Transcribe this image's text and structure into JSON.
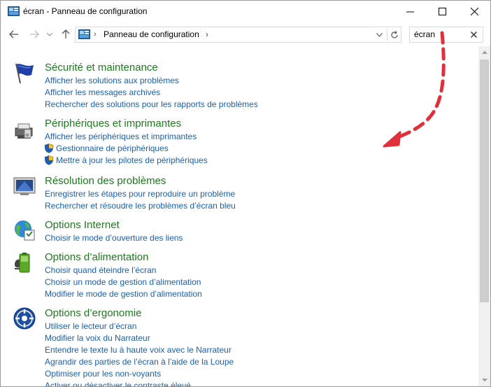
{
  "window": {
    "title": "écran - Panneau de configuration"
  },
  "address": {
    "path_label": "Panneau de configuration",
    "separator": "›"
  },
  "search": {
    "value": "écran"
  },
  "groups": [
    {
      "title": "Sécurité et maintenance",
      "icon": "flag-icon",
      "links": [
        {
          "label": "Afficher les solutions aux problèmes",
          "shield": false
        },
        {
          "label": "Afficher les messages archivés",
          "shield": false
        },
        {
          "label": "Rechercher des solutions pour les rapports de problèmes",
          "shield": false
        }
      ]
    },
    {
      "title": "Périphériques et imprimantes",
      "icon": "printer-icon",
      "links": [
        {
          "label": "Afficher les périphériques et imprimantes",
          "shield": false
        },
        {
          "label": "Gestionnaire de périphériques",
          "shield": true
        },
        {
          "label": "Mettre à jour les pilotes de périphériques",
          "shield": true
        }
      ]
    },
    {
      "title": "Résolution des problèmes",
      "icon": "troubleshoot-monitor-icon",
      "links": [
        {
          "label": "Enregistrer les étapes pour reproduire un problème",
          "shield": false
        },
        {
          "label": "Rechercher et résoudre les problèmes d’écran bleu",
          "shield": false
        }
      ]
    },
    {
      "title": "Options Internet",
      "icon": "globe-icon",
      "links": [
        {
          "label": "Choisir le mode d’ouverture des liens",
          "shield": false
        }
      ]
    },
    {
      "title": "Options d’alimentation",
      "icon": "battery-icon",
      "links": [
        {
          "label": "Choisir quand éteindre l’écran",
          "shield": false
        },
        {
          "label": "Choisir un mode de gestion d’alimentation",
          "shield": false
        },
        {
          "label": "Modifier le mode de gestion d’alimentation",
          "shield": false
        }
      ]
    },
    {
      "title": "Options d’ergonomie",
      "icon": "ease-of-access-icon",
      "links": [
        {
          "label": "Utiliser le lecteur d’écran",
          "shield": false
        },
        {
          "label": "Modifier la voix du Narrateur",
          "shield": false
        },
        {
          "label": "Entendre le texte lu à haute voix avec le Narrateur",
          "shield": false
        },
        {
          "label": "Agrandir des parties de l’écran à l’aide de la Loupe",
          "shield": false
        },
        {
          "label": "Optimiser pour les non-voyants",
          "shield": false
        },
        {
          "label": "Activer ou désactiver le contraste élevé",
          "shield": false
        }
      ]
    }
  ],
  "colors": {
    "title_green": "#1e7a1e",
    "link_blue": "#1a5fb4",
    "annotation_red": "#e0303c"
  }
}
